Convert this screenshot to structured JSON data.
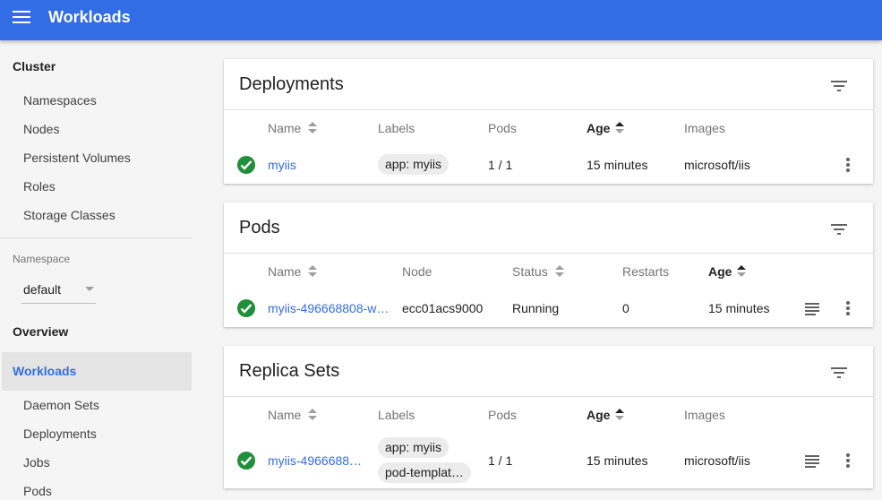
{
  "header": {
    "title": "Workloads",
    "menu_icon": "hamburger-icon"
  },
  "sidebar": {
    "cluster_heading": "Cluster",
    "cluster_items": [
      "Namespaces",
      "Nodes",
      "Persistent Volumes",
      "Roles",
      "Storage Classes"
    ],
    "namespace_label": "Namespace",
    "namespace_value": "default",
    "overview": "Overview",
    "active_item": "Workloads",
    "workload_items": [
      "Daemon Sets",
      "Deployments",
      "Jobs",
      "Pods"
    ]
  },
  "deployments": {
    "title": "Deployments",
    "columns": [
      "Name",
      "Labels",
      "Pods",
      "Age",
      "Images"
    ],
    "rows": [
      {
        "name": "myiis",
        "labels": [
          "app: myiis"
        ],
        "pods": "1 / 1",
        "age": "15 minutes",
        "images": "microsoft/iis"
      }
    ]
  },
  "pods": {
    "title": "Pods",
    "columns": [
      "Name",
      "Node",
      "Status",
      "Restarts",
      "Age"
    ],
    "rows": [
      {
        "name": "myiis-496668808-w…",
        "node": "ecc01acs9000",
        "status": "Running",
        "restarts": "0",
        "age": "15 minutes"
      }
    ]
  },
  "replica_sets": {
    "title": "Replica Sets",
    "columns": [
      "Name",
      "Labels",
      "Pods",
      "Age",
      "Images"
    ],
    "rows": [
      {
        "name": "myiis-4966688…",
        "labels": [
          "app: myiis",
          "pod-templat…"
        ],
        "pods": "1 / 1",
        "age": "15 minutes",
        "images": "microsoft/iis"
      }
    ]
  },
  "colors": {
    "primary": "#326de6",
    "success": "#1f8f3a",
    "sidebar_active": "#e4e4e4"
  },
  "icons": {
    "status": "check-circle-icon",
    "filter": "filter-icon",
    "logs": "logs-icon",
    "more": "more-vert-icon",
    "sort": "sort-icon"
  }
}
